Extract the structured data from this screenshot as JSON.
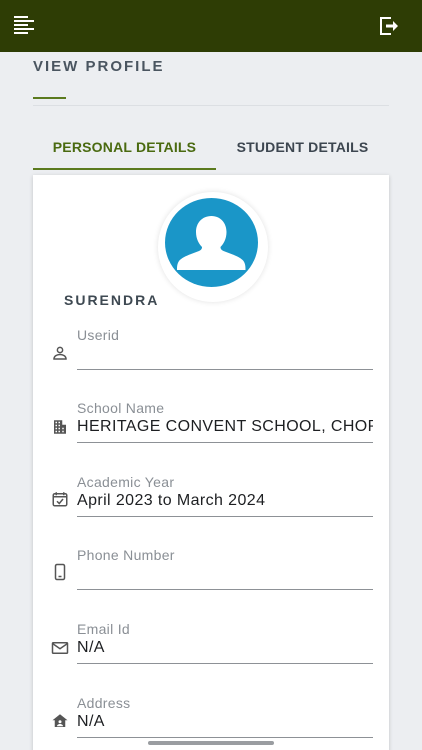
{
  "header": {
    "menu_icon": "menu-icon",
    "logout_icon": "logout-icon",
    "bar_color": "#2e3d05"
  },
  "page": {
    "title": "VIEW PROFILE"
  },
  "tabs": [
    {
      "label": "PERSONAL DETAILS",
      "active": true
    },
    {
      "label": "STUDENT DETAILS",
      "active": false
    }
  ],
  "profile": {
    "avatar_icon": "user-avatar-icon",
    "name": "SURENDRA",
    "fields": [
      {
        "label": "Userid",
        "value": "",
        "icon": "person-icon"
      },
      {
        "label": "School Name",
        "value": "HERITAGE CONVENT SCHOOL, CHOPAN",
        "icon": "building-icon"
      },
      {
        "label": "Academic Year",
        "value": "April 2023 to March 2024",
        "icon": "calendar-icon"
      },
      {
        "label": "Phone Number",
        "value": "",
        "icon": "phone-icon"
      },
      {
        "label": "Email Id",
        "value": "N/A",
        "icon": "email-icon"
      },
      {
        "label": "Address",
        "value": "N/A",
        "icon": "home-icon"
      }
    ]
  },
  "colors": {
    "accent": "#5b7a1e",
    "avatar_bg": "#1a96c8"
  }
}
